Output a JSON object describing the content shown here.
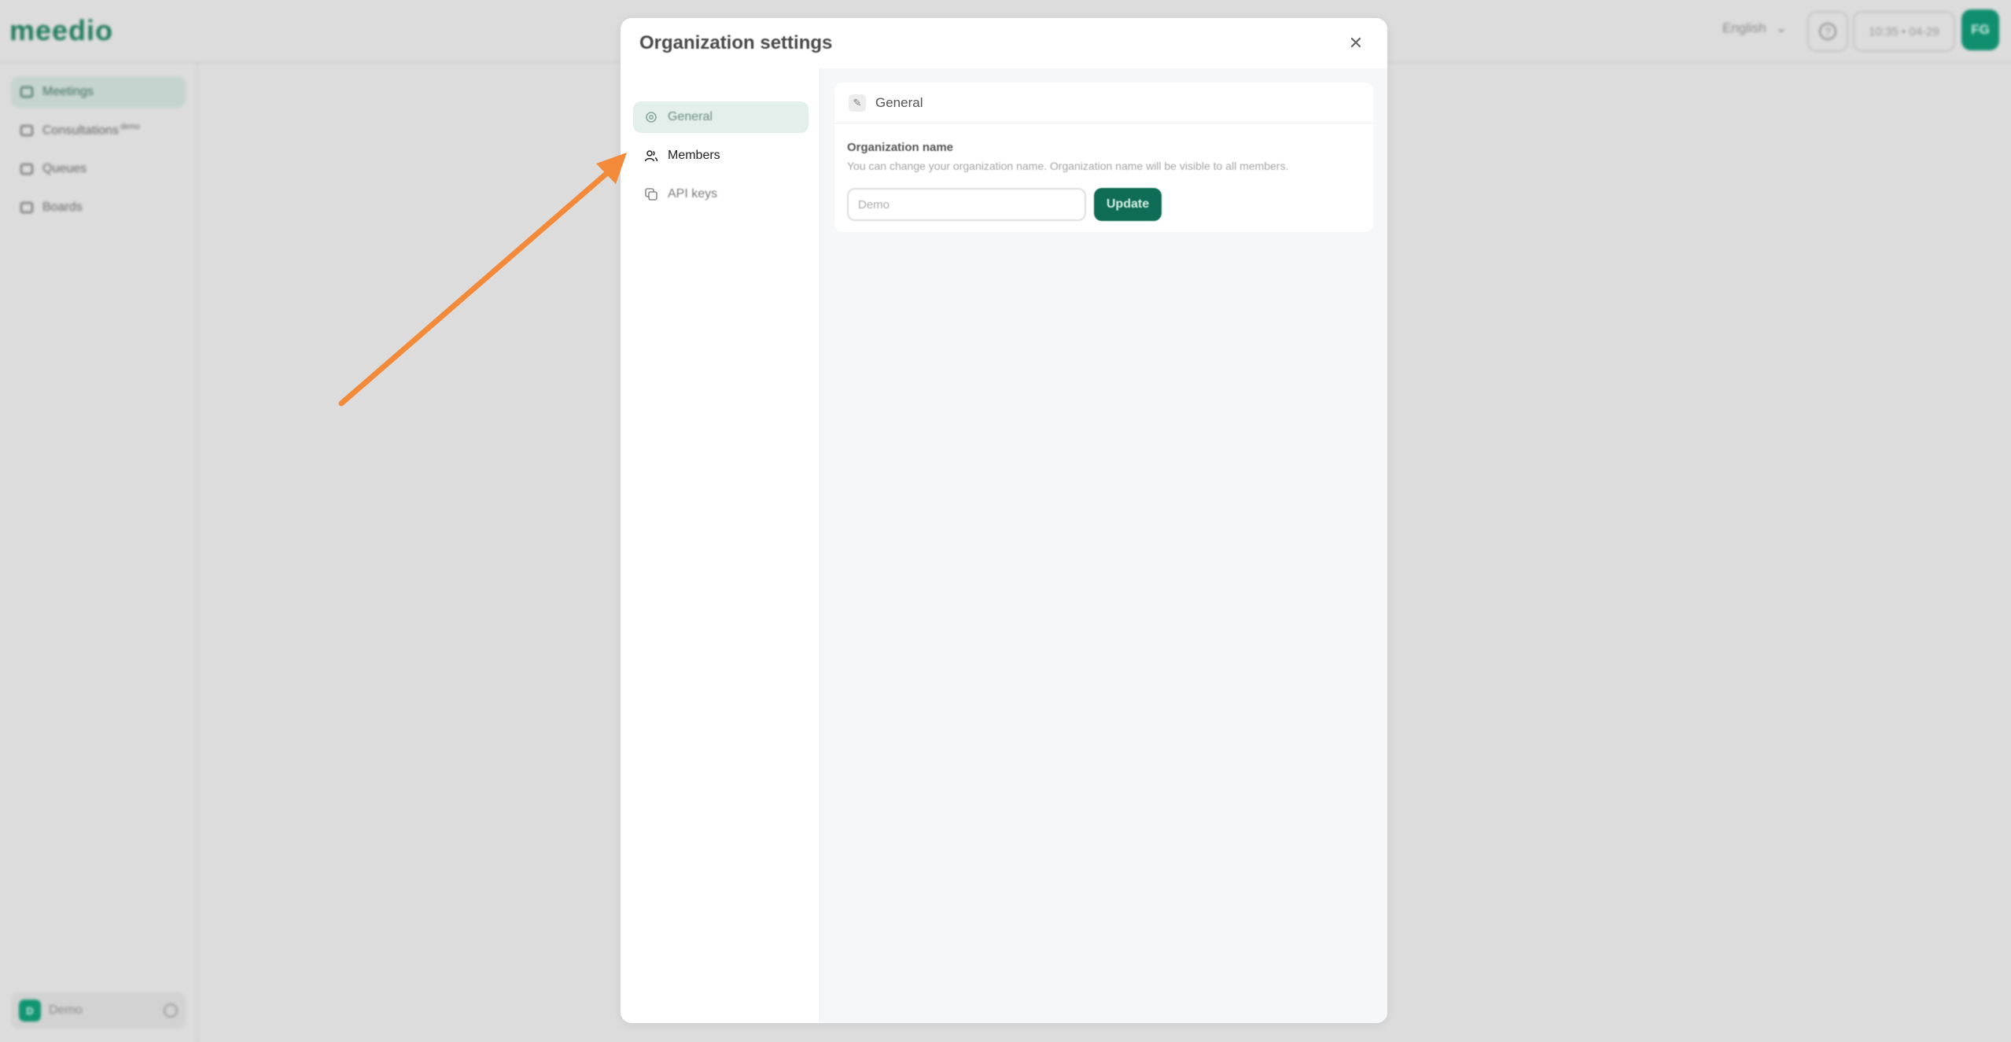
{
  "app": {
    "logo": "meedio",
    "language": "English",
    "clock": "10:35 • 04-29",
    "user_initials": "FG"
  },
  "sidebar": {
    "items": [
      {
        "label": "Meetings",
        "icon": "video-icon",
        "active": true
      },
      {
        "label": "Consultations",
        "badge": "demo",
        "icon": "video-plus-icon"
      },
      {
        "label": "Queues",
        "icon": "stack-icon"
      },
      {
        "label": "Boards",
        "icon": "grid-icon"
      }
    ],
    "workspace": {
      "initial": "D",
      "name": "Demo"
    }
  },
  "modal": {
    "title": "Organization settings",
    "nav": [
      {
        "label": "General",
        "icon": "gear-icon",
        "active": true
      },
      {
        "label": "Members",
        "icon": "users-icon"
      },
      {
        "label": "API keys",
        "icon": "copy-icon"
      }
    ],
    "section": {
      "title": "General",
      "icon": "pencil-icon",
      "field_label": "Organization name",
      "field_help": "You can change your organization name. Organization name will be visible to all members.",
      "input_value": "Demo",
      "update_label": "Update"
    }
  },
  "annotation": {
    "arrow_color": "#f28a3a"
  }
}
